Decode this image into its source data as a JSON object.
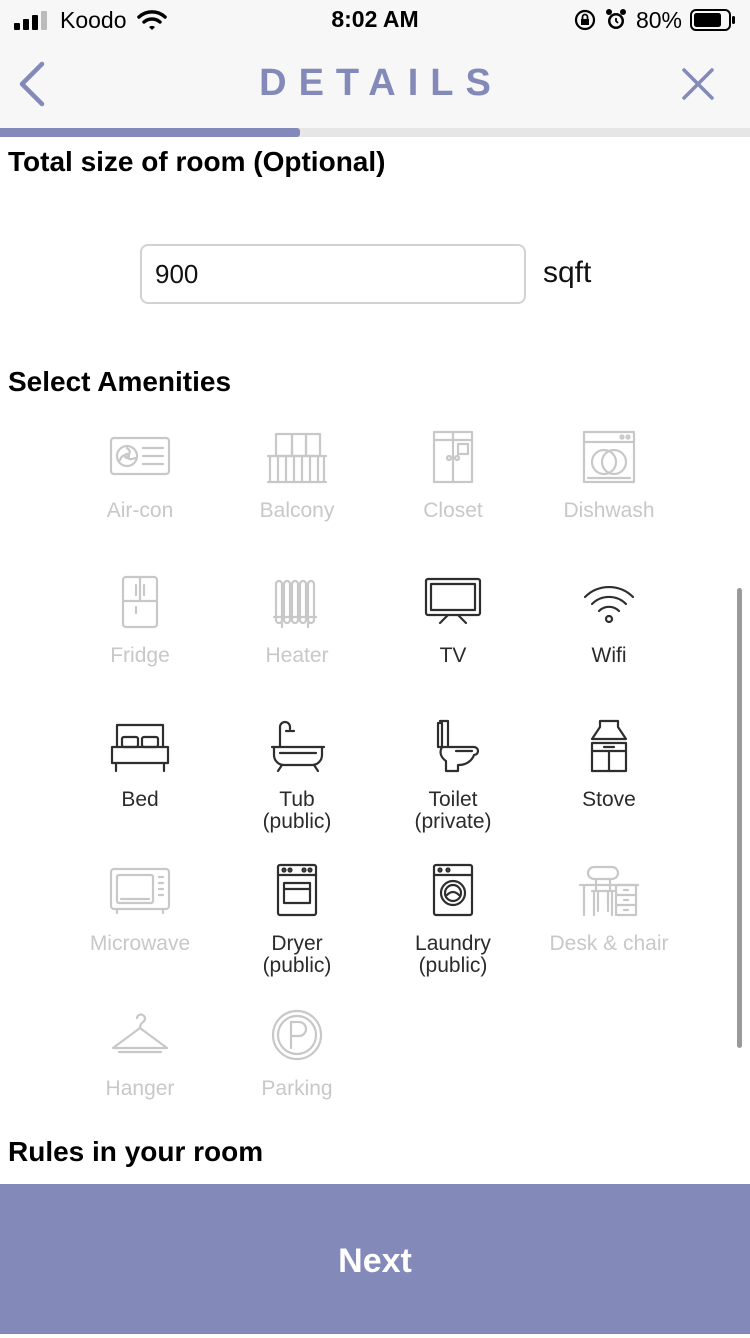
{
  "status_bar": {
    "carrier": "Koodo",
    "time": "8:02 AM",
    "battery": "80%"
  },
  "nav": {
    "title": "DETAILS",
    "progress": 0.4
  },
  "room_size": {
    "title": "Total size of room (Optional)",
    "value": "900",
    "unit": "sqft"
  },
  "amenities": {
    "title": "Select Amenities",
    "items": [
      {
        "label": "Air-con",
        "icon": "aircon-icon",
        "selected": false
      },
      {
        "label": "Balcony",
        "icon": "balcony-icon",
        "selected": false
      },
      {
        "label": "Closet",
        "icon": "closet-icon",
        "selected": false
      },
      {
        "label": "Dishwash",
        "icon": "dishwasher-icon",
        "selected": false
      },
      {
        "label": "Fridge",
        "icon": "fridge-icon",
        "selected": false
      },
      {
        "label": "Heater",
        "icon": "heater-icon",
        "selected": false
      },
      {
        "label": "TV",
        "icon": "tv-icon",
        "selected": true
      },
      {
        "label": "Wifi",
        "icon": "wifi-icon",
        "selected": true
      },
      {
        "label": "Bed",
        "icon": "bed-icon",
        "selected": true
      },
      {
        "label": "Tub\n(public)",
        "icon": "bathtub-icon",
        "selected": true
      },
      {
        "label": "Toilet\n(private)",
        "icon": "toilet-icon",
        "selected": true
      },
      {
        "label": "Stove",
        "icon": "stove-icon",
        "selected": true
      },
      {
        "label": "Microwave",
        "icon": "microwave-icon",
        "selected": false
      },
      {
        "label": "Dryer\n(public)",
        "icon": "dryer-icon",
        "selected": true
      },
      {
        "label": "Laundry\n(public)",
        "icon": "washing-machine-icon",
        "selected": true
      },
      {
        "label": "Desk & chair",
        "icon": "desk-chair-icon",
        "selected": false
      },
      {
        "label": "Hanger",
        "icon": "hanger-icon",
        "selected": false
      },
      {
        "label": "Parking",
        "icon": "parking-icon",
        "selected": false
      }
    ]
  },
  "rules": {
    "title": "Rules in your room"
  },
  "footer": {
    "next_label": "Next"
  },
  "colors": {
    "accent": "#8389b8",
    "selected": "#2e2e2e",
    "unselected": "#c8c8c8"
  }
}
